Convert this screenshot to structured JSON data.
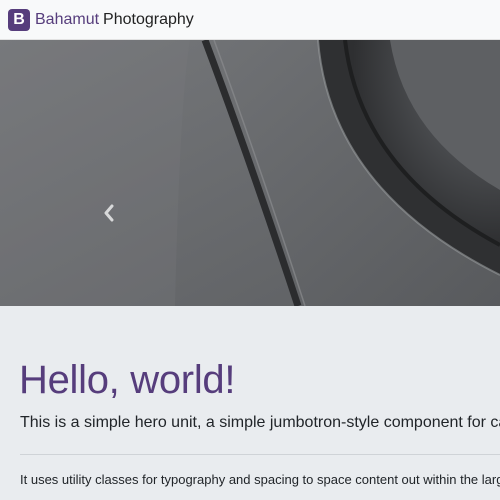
{
  "navbar": {
    "logo_letter": "B",
    "brand_name": "Bahamut",
    "brand_suffix": "Photography"
  },
  "carousel": {
    "prev_icon": "chevron-left-icon"
  },
  "jumbotron": {
    "title": "Hello, world!",
    "lead": "This is a simple hero unit, a simple jumbotron-style component for calling e",
    "body": "It uses utility classes for typography and spacing to space content out within the large"
  },
  "colors": {
    "brand": "#563d7c",
    "jumbotron_bg": "#e9ecef",
    "navbar_bg": "#f8f9fa"
  }
}
